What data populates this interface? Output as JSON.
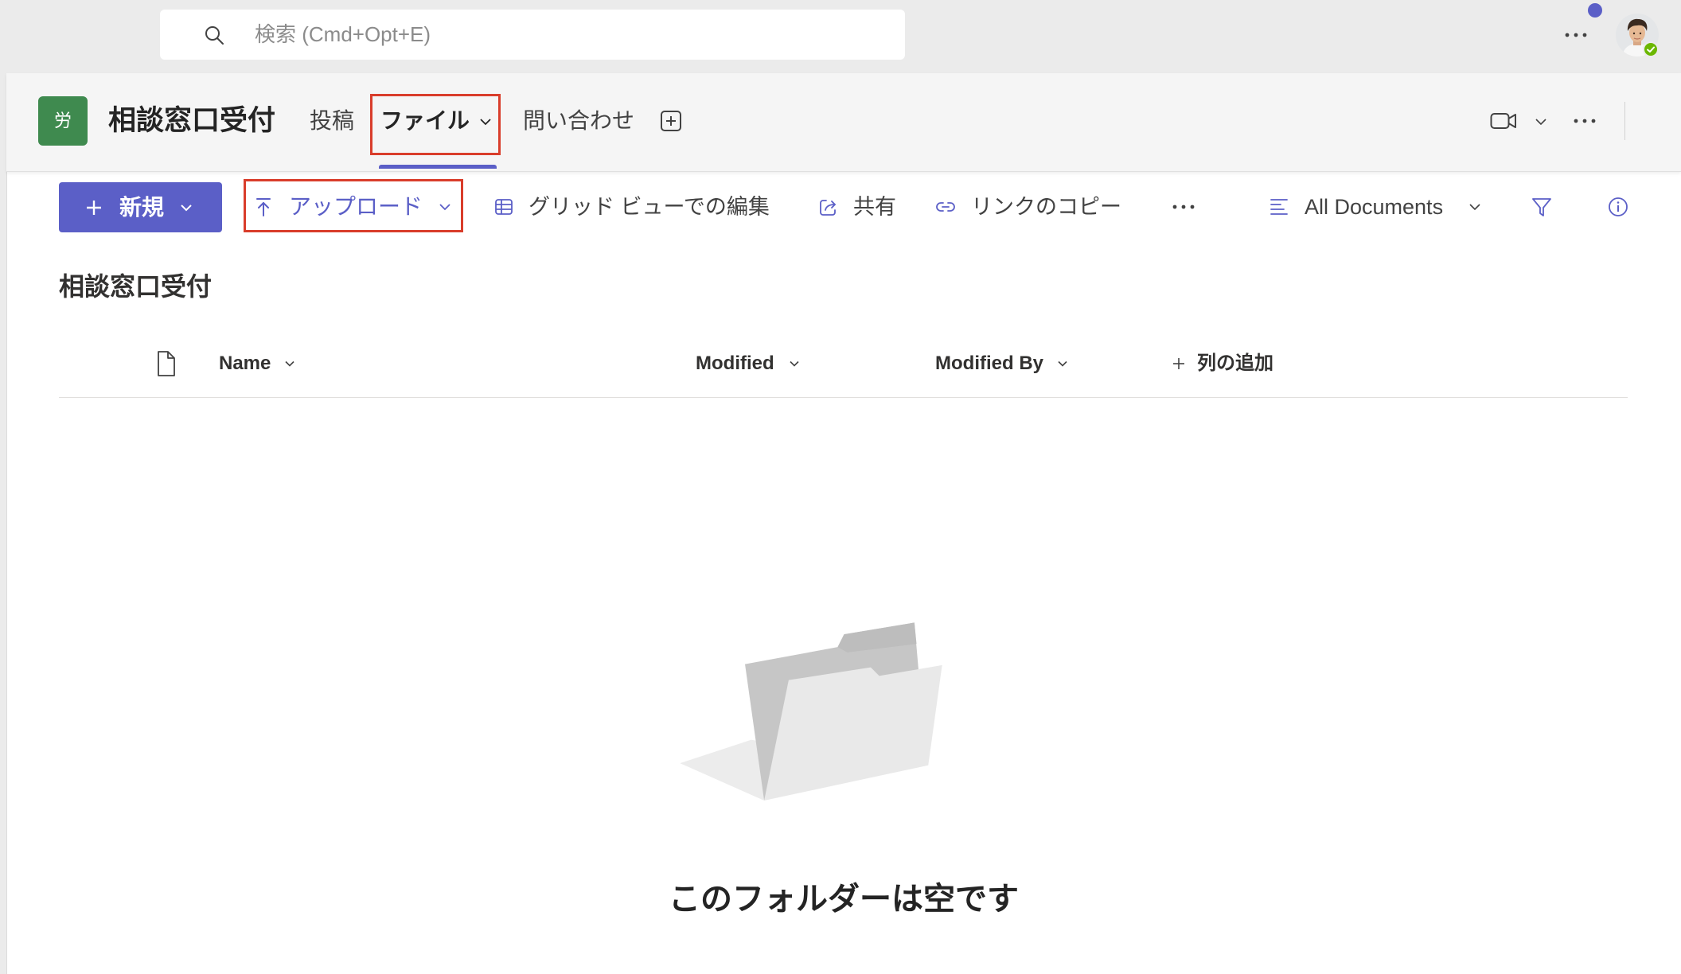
{
  "search": {
    "placeholder": "検索 (Cmd+Opt+E)",
    "icon": "search-icon"
  },
  "account": {
    "more_icon": "more-horizontal-icon",
    "avatar_icon": "user-avatar",
    "presence_icon": "available-check-icon",
    "has_notification": true
  },
  "team": {
    "avatar_letter": "労",
    "name": "相談窓口受付"
  },
  "tabs": [
    {
      "label": "投稿",
      "active": false
    },
    {
      "label": "ファイル",
      "active": true,
      "has_dropdown": true
    },
    {
      "label": "問い合わせ",
      "active": false
    }
  ],
  "header_actions": {
    "icons": [
      "add-tab-icon",
      "video-call-icon",
      "chevron-down-icon",
      "more-horizontal-icon"
    ]
  },
  "toolbar": {
    "new_label": "新規",
    "upload_label": "アップロード",
    "grid_edit_label": "グリッド ビューでの編集",
    "share_label": "共有",
    "copy_link_label": "リンクのコピー",
    "view_label": "All Documents",
    "icons": [
      "plus-icon",
      "upload-icon",
      "grid-icon",
      "share-icon",
      "link-icon",
      "more-horizontal-icon",
      "list-view-icon",
      "filter-icon",
      "info-icon"
    ]
  },
  "library": {
    "title": "相談窓口受付",
    "columns": [
      {
        "label": "Name"
      },
      {
        "label": "Modified"
      },
      {
        "label": "Modified By"
      }
    ],
    "add_column_label": "列の追加",
    "items": [],
    "empty_illustration": "empty-folder-illustration",
    "empty_message": "このフォルダーは空です"
  },
  "colors": {
    "accent": "#5b5fc7",
    "team_avatar": "#3f8a4f",
    "highlight": "#d93d2b",
    "presence": "#6bb700",
    "top_bar": "#ebebeb",
    "header_bg": "#f5f5f5"
  }
}
